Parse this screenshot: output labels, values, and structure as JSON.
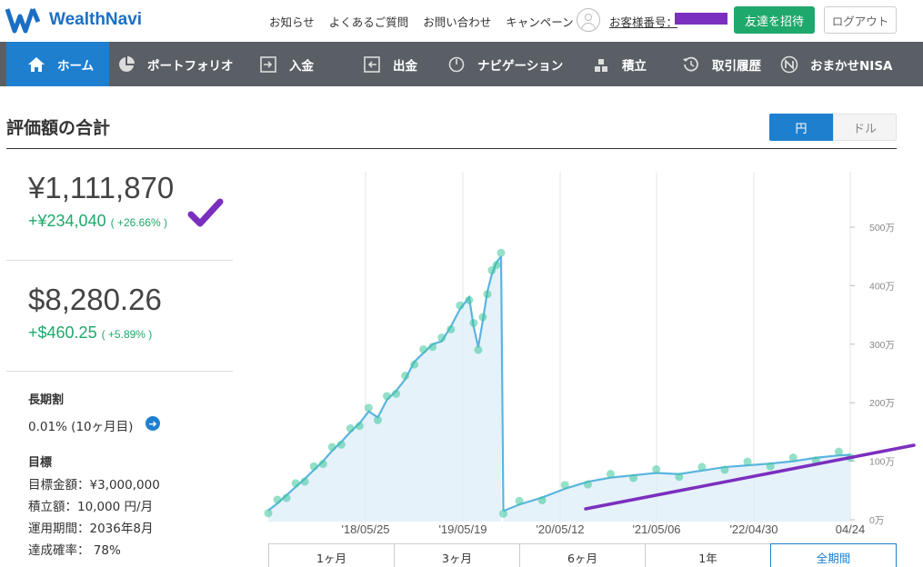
{
  "header": {
    "logo_text": "WealthNavi",
    "links": [
      "お知らせ",
      "よくあるご質問",
      "お問い合わせ",
      "キャンペーン"
    ],
    "customer_label": "お客様番号：",
    "invite_button": "友達を招待",
    "logout_button": "ログアウト"
  },
  "nav": {
    "items": [
      {
        "label": "ホーム",
        "icon": "home-icon",
        "active": true
      },
      {
        "label": "ポートフォリオ",
        "icon": "pie-chart-icon",
        "active": false
      },
      {
        "label": "入金",
        "icon": "deposit-icon",
        "active": false
      },
      {
        "label": "出金",
        "icon": "withdraw-icon",
        "active": false
      },
      {
        "label": "ナビゲーション",
        "icon": "navigation-icon",
        "active": false
      },
      {
        "label": "積立",
        "icon": "accumulate-icon",
        "active": false
      },
      {
        "label": "取引履歴",
        "icon": "history-icon",
        "active": false
      },
      {
        "label": "おまかせNISA",
        "icon": "nisa-icon",
        "active": false
      }
    ]
  },
  "main": {
    "title": "評価額の合計",
    "currency_toggle": {
      "yen": "円",
      "usd": "ドル",
      "selected": "円"
    },
    "jpy": {
      "amount": "¥1,111,870",
      "gain": "+¥234,040",
      "gain_pct": "( +26.66% )"
    },
    "usd": {
      "amount": "$8,280.26",
      "gain": "+$460.25",
      "gain_pct": "( +5.89% )"
    },
    "long_term": {
      "label": "長期割",
      "value": "0.01% (10ヶ月目)"
    },
    "goal": {
      "label": "目標",
      "target": "目標金額：¥3,000,000",
      "monthly": "積立額：10,000 円/月",
      "period": "運用期間：2036年8月",
      "probability": "達成確率：  78%"
    }
  },
  "period_tabs": [
    "1ヶ月",
    "3ヶ月",
    "6ヶ月",
    "1年",
    "全期間"
  ],
  "period_selected": "全期間",
  "colors": {
    "brand": "#1a6fc4",
    "accent": "#1e7fcf",
    "gain": "#1fa86b",
    "nav_bg": "#5a5f66",
    "annotation": "#7b2fbe"
  },
  "chart_data": {
    "type": "line",
    "y_ticks": [
      "500万",
      "400万",
      "300万",
      "200万",
      "100万",
      "0万"
    ],
    "x_ticks": [
      "'18/05/25",
      "'19/05/19",
      "'20/05/12",
      "'21/05/06",
      "'22/04/30",
      "04/24"
    ],
    "ylim": [
      0,
      5000000
    ],
    "series": [
      {
        "values_note": "",
        "points": [
          [
            0,
            160000
          ],
          [
            0.04,
            280000
          ],
          [
            0.08,
            420000
          ],
          [
            0.12,
            560000
          ],
          [
            0.16,
            700000
          ],
          [
            0.2,
            850000
          ],
          [
            0.24,
            1000000
          ],
          [
            0.28,
            1180000
          ],
          [
            0.32,
            1330000
          ],
          [
            0.36,
            1500000
          ],
          [
            0.4,
            1650000
          ],
          [
            0.44,
            1850000
          ],
          [
            0.48,
            1750000
          ],
          [
            0.52,
            2050000
          ],
          [
            0.56,
            2200000
          ],
          [
            0.6,
            2400000
          ],
          [
            0.64,
            2700000
          ],
          [
            0.68,
            2850000
          ],
          [
            0.72,
            3000000
          ],
          [
            0.76,
            3050000
          ],
          [
            0.8,
            3300000
          ],
          [
            0.84,
            3600000
          ],
          [
            0.88,
            3800000
          ],
          [
            0.9,
            3300000
          ],
          [
            0.92,
            2950000
          ],
          [
            0.94,
            3400000
          ],
          [
            0.96,
            3900000
          ],
          [
            0.98,
            4200000
          ],
          [
            1.0,
            4400000
          ],
          [
            1.02,
            4500000
          ]
        ]
      },
      {
        "values_note": "",
        "points": [
          [
            1.03,
            150000
          ],
          [
            1.1,
            260000
          ],
          [
            1.2,
            380000
          ],
          [
            1.3,
            530000
          ],
          [
            1.4,
            650000
          ],
          [
            1.5,
            720000
          ],
          [
            1.6,
            760000
          ],
          [
            1.7,
            800000
          ],
          [
            1.8,
            780000
          ],
          [
            1.9,
            840000
          ],
          [
            2.0,
            900000
          ],
          [
            2.1,
            930000
          ],
          [
            2.2,
            960000
          ],
          [
            2.3,
            1000000
          ],
          [
            2.4,
            1060000
          ],
          [
            2.5,
            1100000
          ],
          [
            2.55,
            1110000
          ]
        ]
      }
    ]
  }
}
